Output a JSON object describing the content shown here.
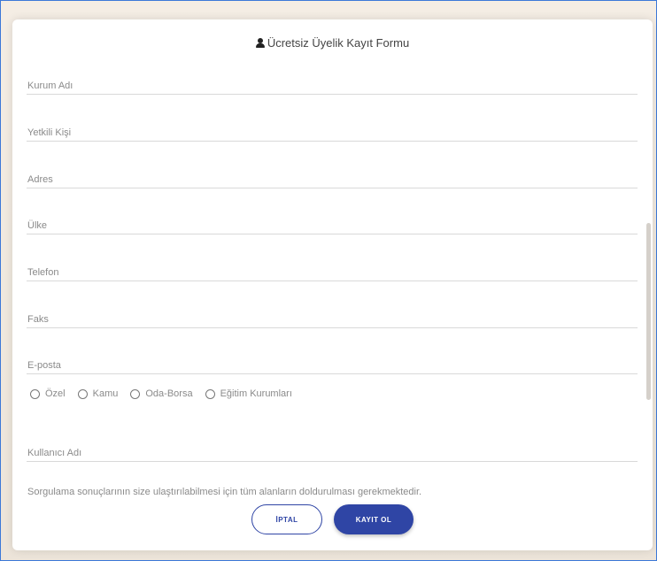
{
  "form": {
    "title": "Ücretsiz Üyelik Kayıt Formu",
    "fields": [
      {
        "label": "Kurum Adı"
      },
      {
        "label": "Yetkili Kişi"
      },
      {
        "label": "Adres"
      },
      {
        "label": "Ülke"
      },
      {
        "label": "Telefon"
      },
      {
        "label": "Faks"
      },
      {
        "label": "E-posta"
      },
      {
        "label": "Kullanıcı Adı"
      }
    ],
    "types": [
      "Özel",
      "Kamu",
      "Oda-Borsa",
      "Eğitim Kurumları"
    ],
    "note": "Sorgulama sonuçlarının size ulaştırılabilmesi için tüm alanların doldurulması gerekmektedir.",
    "cancel_label": "İPTAL",
    "submit_label": "KAYIT OL"
  },
  "colors": {
    "accent": "#2f45a5"
  }
}
